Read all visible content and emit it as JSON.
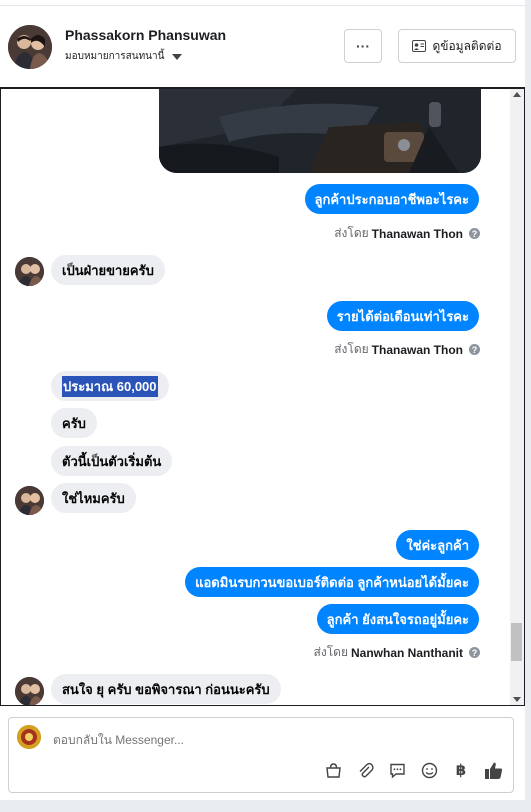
{
  "header": {
    "name": "Phassakorn Phansuwan",
    "assign_label": "มอบหมายการสนทนานี้",
    "more_label": "···",
    "contact_label": "ดูข้อมูลติดต่อ"
  },
  "messages": [
    {
      "text": "ลูกค้าประกอบอาชีพอะไรคะ"
    },
    {
      "sent_prefix": "ส่งโดย",
      "sent_name": "Thanawan Thon"
    },
    {
      "text": "เป็นฝ่ายขายครับ"
    },
    {
      "text": "รายได้ต่อเดือนเท่าไรคะ"
    },
    {
      "sent_prefix": "ส่งโดย",
      "sent_name": "Thanawan Thon"
    },
    {
      "text": "ประมาณ 60,000"
    },
    {
      "text": "ครับ"
    },
    {
      "text": "ตัวนี้เป็นตัวเริ่มต้น"
    },
    {
      "text": "ใช่ไหมครับ"
    },
    {
      "text": "ใช่ค่ะลูกค้า"
    },
    {
      "text": "แอดมินรบกวนขอเบอร์ติดต่อ ลูกค้าหน่อยได้มั้ยคะ"
    },
    {
      "text": "ลูกค้า ยังสนใจรถอยู่มั้ยคะ"
    },
    {
      "sent_prefix": "ส่งโดย",
      "sent_name": "Nanwhan Nanthanit"
    },
    {
      "text": "สนใจ ยุ ครับ ขอพิจารณา ก่อนนะครับ"
    }
  ],
  "composer": {
    "placeholder": "ตอบกลับใน Messenger..."
  },
  "icons": {
    "info": "?",
    "baht": "฿"
  },
  "colors": {
    "outgoing_bubble": "#0084ff",
    "incoming_bubble": "#eceef1",
    "highlight": "#2b54b8"
  }
}
